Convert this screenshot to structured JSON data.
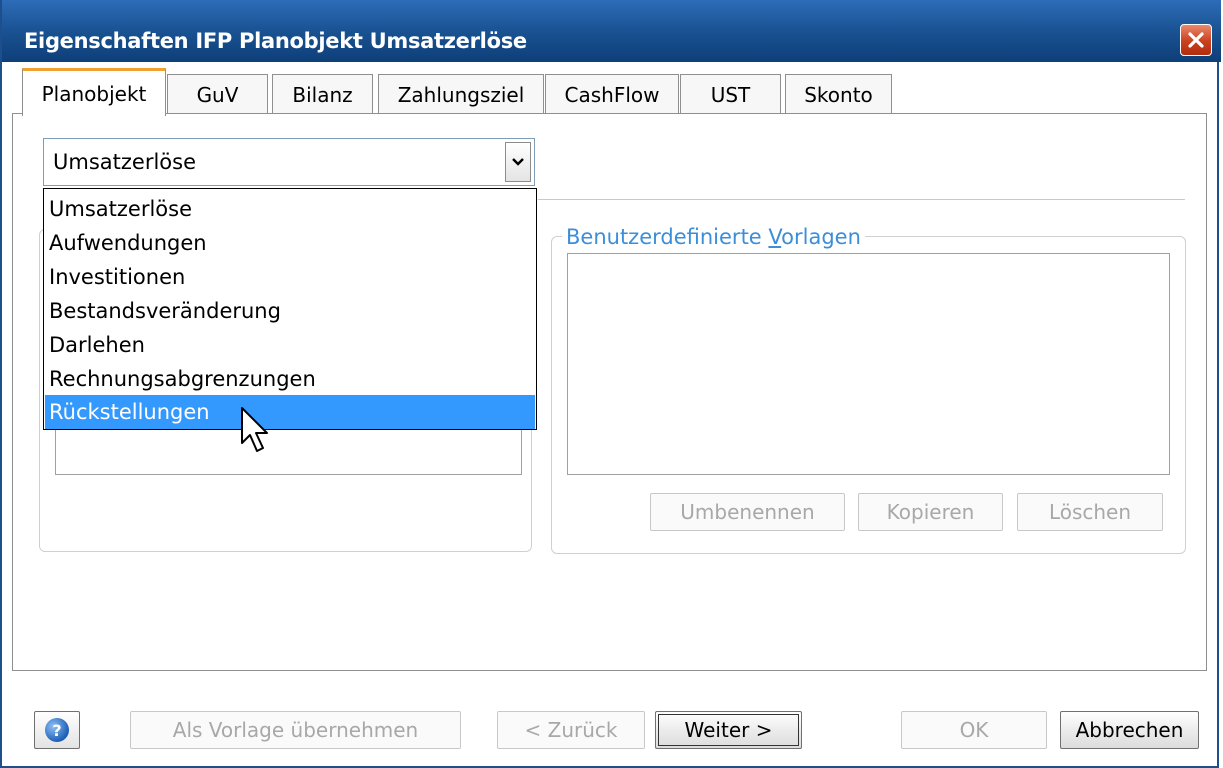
{
  "window": {
    "title": "Eigenschaften IFP Planobjekt Umsatzerlöse"
  },
  "tabs": [
    {
      "label": "Planobjekt",
      "active": true
    },
    {
      "label": "GuV"
    },
    {
      "label": "Bilanz"
    },
    {
      "label": "Zahlungsziel"
    },
    {
      "label": "CashFlow"
    },
    {
      "label": "UST"
    },
    {
      "label": "Skonto"
    }
  ],
  "type_combo": {
    "value": "Umsatzerlöse"
  },
  "dropdown": {
    "items": [
      "Umsatzerlöse",
      "Aufwendungen",
      "Investitionen",
      "Bestandsveränderung",
      "Darlehen",
      "Rechnungsabgrenzungen",
      "Rückstellungen"
    ],
    "highlighted": "Rückstellungen"
  },
  "templates_group": {
    "label_pre": "Benutzerdefinierte ",
    "label_accel": "V",
    "label_post": "orlagen",
    "buttons": {
      "rename": "Umbenennen",
      "copy": "Kopieren",
      "delete": "Löschen"
    }
  },
  "footer": {
    "help": "?",
    "use_as_template": "Als Vorlage übernehmen",
    "back": "< Zurück",
    "next": "Weiter >",
    "ok": "OK",
    "cancel": "Abbrechen"
  },
  "colors": {
    "titlebar": "#18508f",
    "tab_accent": "#f2a02f",
    "selection": "#3399ff",
    "group_label": "#3c8ed8"
  }
}
